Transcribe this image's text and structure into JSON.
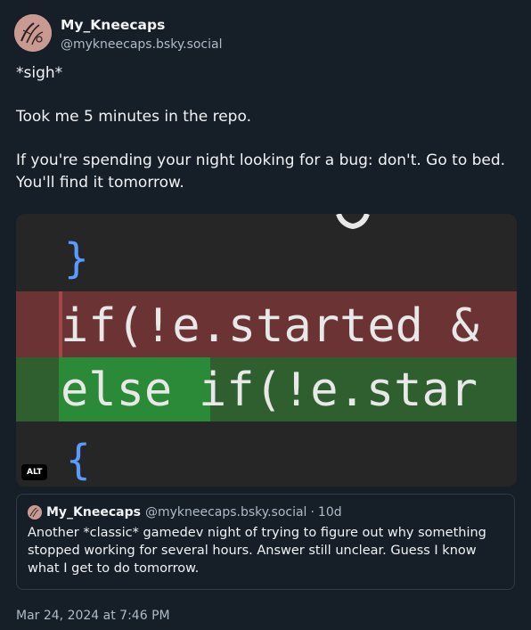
{
  "author": {
    "display_name": "My_Kneecaps",
    "handle": "@mykneecaps.bsky.social",
    "avatar_icon": "sketch-avatar"
  },
  "post": {
    "paragraphs": [
      "*sigh*",
      "Took me 5 minutes in the repo.",
      "If you're spending your night looking for a bug: don't. Go to bed. You'll find it tomorrow."
    ],
    "timestamp": "Mar 24, 2024 at 7:46 PM"
  },
  "image": {
    "alt_badge": "ALT",
    "code_lines": {
      "brace_close": "}",
      "removed": "if(!e.started &",
      "added_keyword": "else",
      "added_rest": " if(!e.star",
      "brace_open": "{"
    },
    "colors": {
      "background": "#262626",
      "removed_line": "#6b3333",
      "added_line": "#2f5f2f",
      "added_highlight": "#2b8a38",
      "text": "#e8e8e8",
      "brace": "#5b9bff"
    }
  },
  "quote": {
    "display_name": "My_Kneecaps",
    "handle": "@mykneecaps.bsky.social",
    "separator": "·",
    "age": "10d",
    "text": "Another *classic* gamedev night of trying to figure out why something stopped working for several hours. Answer still unclear. Guess I know what I get to do tomorrow."
  }
}
